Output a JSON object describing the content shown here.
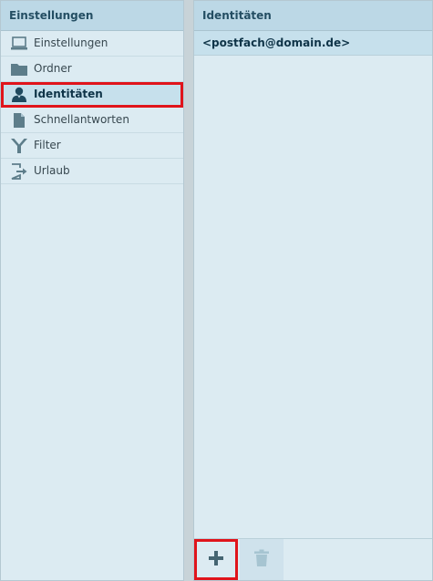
{
  "left_panel": {
    "title": "Einstellungen",
    "items": [
      {
        "label": "Einstellungen",
        "icon": "laptop-icon"
      },
      {
        "label": "Ordner",
        "icon": "folder-icon"
      },
      {
        "label": "Identitäten",
        "icon": "user-icon",
        "selected": true
      },
      {
        "label": "Schnellantworten",
        "icon": "document-icon"
      },
      {
        "label": "Filter",
        "icon": "filter-icon"
      },
      {
        "label": "Urlaub",
        "icon": "exit-icon"
      }
    ]
  },
  "right_panel": {
    "title": "Identitäten",
    "identities": [
      "<postfach@domain.de>"
    ]
  },
  "footer": {
    "add_icon": "plus-icon",
    "delete_icon": "trash-icon",
    "delete_enabled": false
  },
  "colors": {
    "header_bg": "#bcd8e6",
    "panel_bg": "#dcebf2",
    "selected_bg": "#c6e0ec",
    "highlight_outline": "#e0141b",
    "icon_color": "#5d7d8a",
    "active_icon_color": "#1f4a5f"
  }
}
